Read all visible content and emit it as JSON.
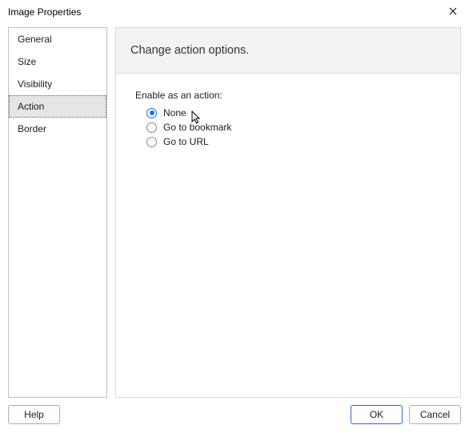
{
  "dialog": {
    "title": "Image Properties"
  },
  "sidebar": {
    "items": [
      {
        "label": "General",
        "selected": false
      },
      {
        "label": "Size",
        "selected": false
      },
      {
        "label": "Visibility",
        "selected": false
      },
      {
        "label": "Action",
        "selected": true
      },
      {
        "label": "Border",
        "selected": false
      }
    ]
  },
  "content": {
    "heading": "Change action options.",
    "group_label": "Enable as an action:",
    "options": [
      {
        "label": "None",
        "checked": true
      },
      {
        "label": "Go to bookmark",
        "checked": false
      },
      {
        "label": "Go to URL",
        "checked": false
      }
    ]
  },
  "buttons": {
    "help": "Help",
    "ok": "OK",
    "cancel": "Cancel"
  }
}
